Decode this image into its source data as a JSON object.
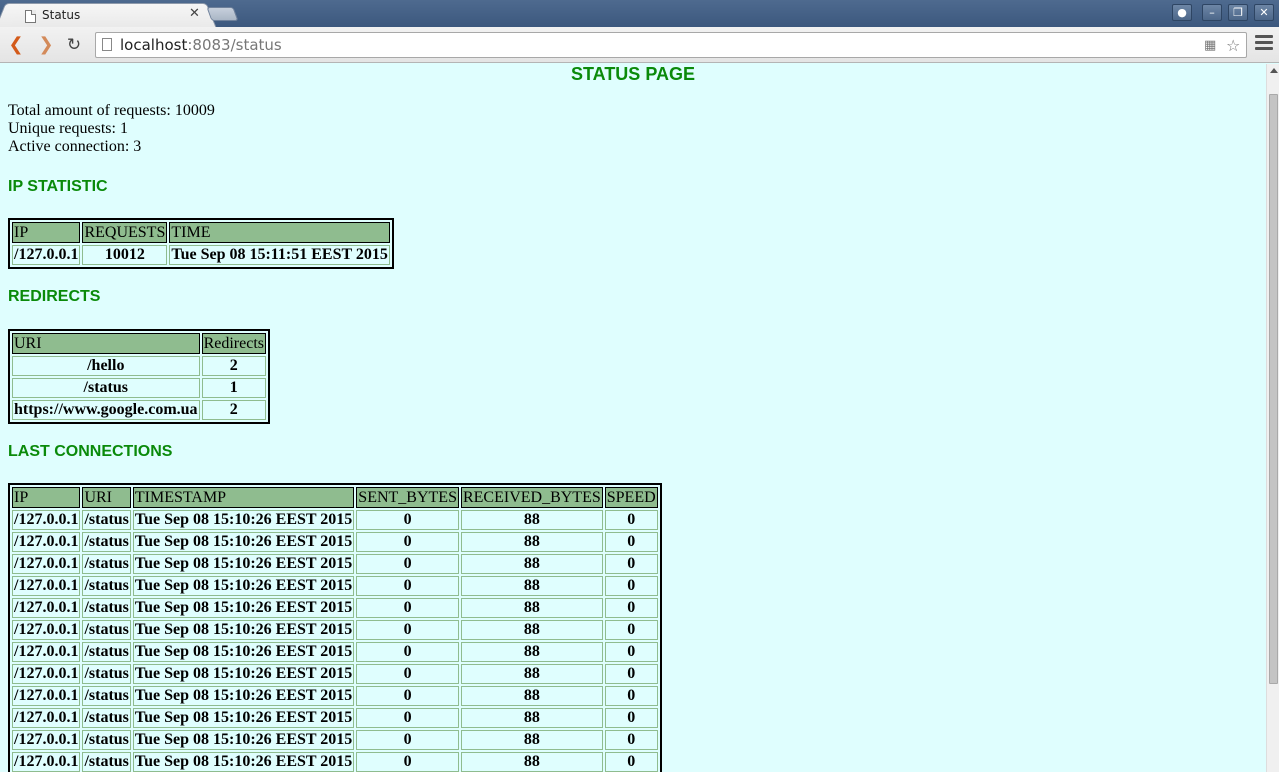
{
  "browser": {
    "tab_title": "Status",
    "url_host": "localhost",
    "url_rest": ":8083/status"
  },
  "page": {
    "title": "STATUS PAGE",
    "total_requests": "Total amount of requests: 10009",
    "unique_requests": "Unique requests: 1",
    "active_connections": "Active connection: 3"
  },
  "ip_statistic": {
    "heading": "IP STATISTIC",
    "columns": [
      "IP",
      "REQUESTS",
      "TIME"
    ],
    "rows": [
      [
        "/127.0.0.1",
        "10012",
        "Tue Sep 08 15:11:51 EEST 2015"
      ]
    ]
  },
  "redirects": {
    "heading": "REDIRECTS",
    "columns": [
      "URI",
      "Redirects"
    ],
    "rows": [
      [
        "/hello",
        "2"
      ],
      [
        "/status",
        "1"
      ],
      [
        "https://www.google.com.ua",
        "2"
      ]
    ]
  },
  "last_connections": {
    "heading": "LAST CONNECTIONS",
    "columns": [
      "IP",
      "URI",
      "TIMESTAMP",
      "SENT_BYTES",
      "RECEIVED_BYTES",
      "SPEED"
    ],
    "rows": [
      [
        "/127.0.0.1",
        "/status",
        "Tue Sep 08 15:10:26 EEST 2015",
        "0",
        "88",
        "0"
      ],
      [
        "/127.0.0.1",
        "/status",
        "Tue Sep 08 15:10:26 EEST 2015",
        "0",
        "88",
        "0"
      ],
      [
        "/127.0.0.1",
        "/status",
        "Tue Sep 08 15:10:26 EEST 2015",
        "0",
        "88",
        "0"
      ],
      [
        "/127.0.0.1",
        "/status",
        "Tue Sep 08 15:10:26 EEST 2015",
        "0",
        "88",
        "0"
      ],
      [
        "/127.0.0.1",
        "/status",
        "Tue Sep 08 15:10:26 EEST 2015",
        "0",
        "88",
        "0"
      ],
      [
        "/127.0.0.1",
        "/status",
        "Tue Sep 08 15:10:26 EEST 2015",
        "0",
        "88",
        "0"
      ],
      [
        "/127.0.0.1",
        "/status",
        "Tue Sep 08 15:10:26 EEST 2015",
        "0",
        "88",
        "0"
      ],
      [
        "/127.0.0.1",
        "/status",
        "Tue Sep 08 15:10:26 EEST 2015",
        "0",
        "88",
        "0"
      ],
      [
        "/127.0.0.1",
        "/status",
        "Tue Sep 08 15:10:26 EEST 2015",
        "0",
        "88",
        "0"
      ],
      [
        "/127.0.0.1",
        "/status",
        "Tue Sep 08 15:10:26 EEST 2015",
        "0",
        "88",
        "0"
      ],
      [
        "/127.0.0.1",
        "/status",
        "Tue Sep 08 15:10:26 EEST 2015",
        "0",
        "88",
        "0"
      ],
      [
        "/127.0.0.1",
        "/status",
        "Tue Sep 08 15:10:26 EEST 2015",
        "0",
        "88",
        "0"
      ]
    ]
  }
}
